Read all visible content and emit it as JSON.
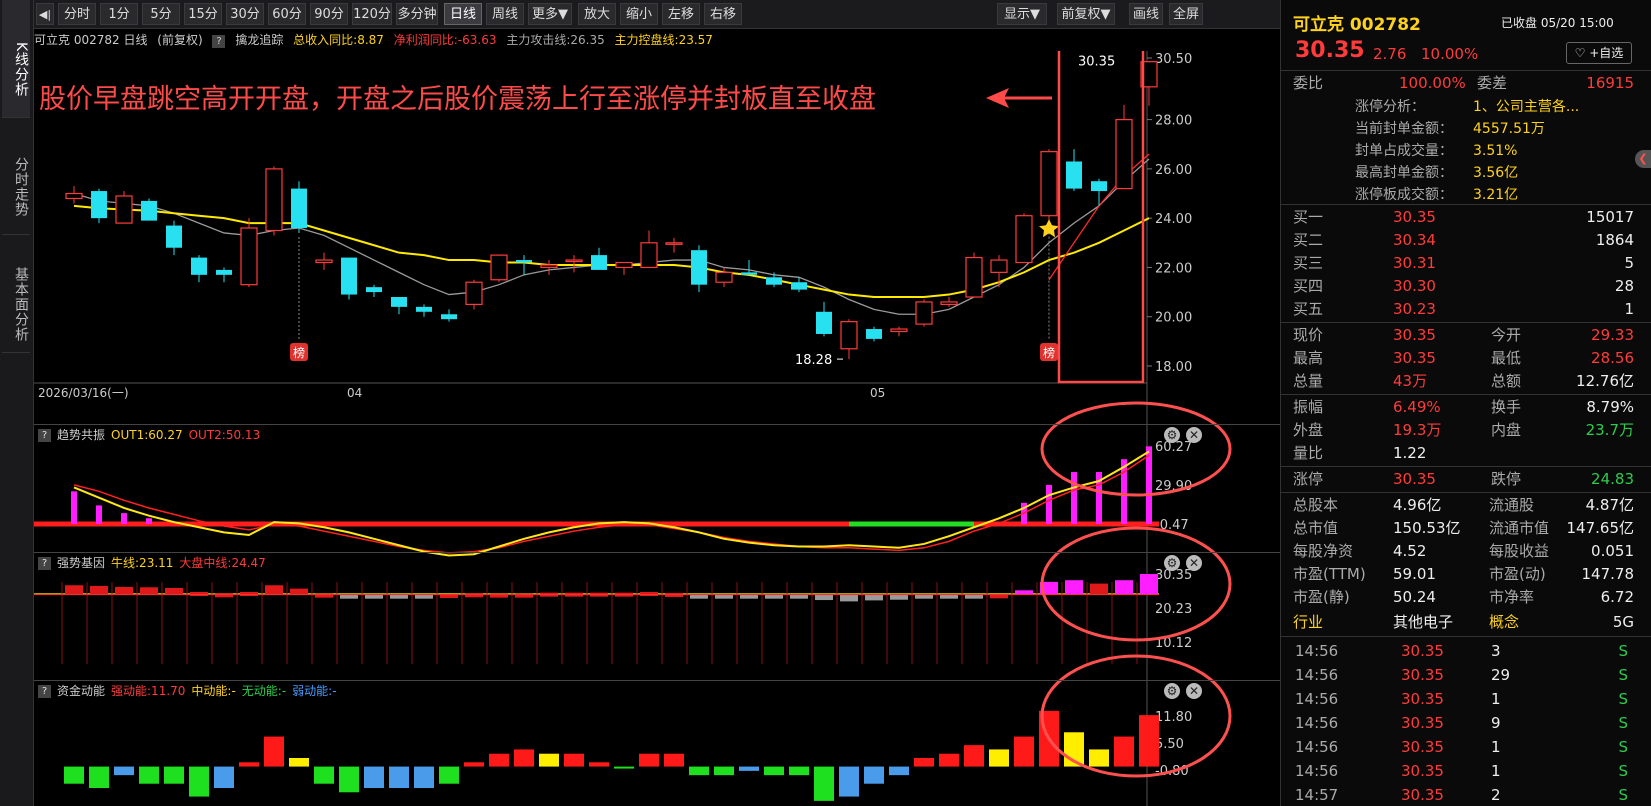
{
  "left_tabs": [
    "K线分析",
    "分时走势",
    "基本面分析"
  ],
  "toolbar": {
    "back": "◀|",
    "items": [
      "分时",
      "1分",
      "5分",
      "15分",
      "30分",
      "60分",
      "90分",
      "120分",
      "多分钟",
      "日线",
      "周线",
      "更多▼",
      "放大",
      "缩小",
      "左移",
      "右移"
    ],
    "right": [
      "显示▼",
      "前复权▼",
      "画线",
      "全屏"
    ]
  },
  "info": {
    "name": "可立克 002782 日线",
    "fq": "(前复权)",
    "q": "?",
    "ind": "擒龙追踪",
    "a": "总收入同比:8.87",
    "b": "净利润同比:-63.63",
    "c": "主力攻击线:26.35",
    "d": "主力控盘线:23.57"
  },
  "annotation": "股价早盘跳空高开开盘，开盘之后股价震荡上行至涨停并封板直至收盘",
  "main_chart": {
    "y_ticks": [
      "30.50",
      "28.00",
      "26.00",
      "24.00",
      "22.00",
      "20.00",
      "18.00"
    ],
    "x_labels": [
      "2026/03/16(一)",
      "04",
      "05"
    ],
    "high_label": "30.35",
    "low_label": "18.28",
    "bang": "榜",
    "candles": [
      [
        24.8,
        25.3,
        24.6,
        25.0
      ],
      [
        25.1,
        25.2,
        23.8,
        24.0
      ],
      [
        23.8,
        25.1,
        23.8,
        24.9
      ],
      [
        24.7,
        24.8,
        23.9,
        23.9
      ],
      [
        23.7,
        23.9,
        22.5,
        22.8
      ],
      [
        22.4,
        22.5,
        21.4,
        21.7
      ],
      [
        21.9,
        22.0,
        21.4,
        21.7
      ],
      [
        21.3,
        24.0,
        21.2,
        23.6
      ],
      [
        23.5,
        26.1,
        23.3,
        26.0
      ],
      [
        25.2,
        25.5,
        23.4,
        23.6
      ],
      [
        22.2,
        22.6,
        21.9,
        22.3
      ],
      [
        22.4,
        22.4,
        20.7,
        20.9
      ],
      [
        21.2,
        21.3,
        20.8,
        21.0
      ],
      [
        20.8,
        20.8,
        20.1,
        20.4
      ],
      [
        20.4,
        20.5,
        20.0,
        20.2
      ],
      [
        20.1,
        20.3,
        19.8,
        19.9
      ],
      [
        20.5,
        21.5,
        20.3,
        21.4
      ],
      [
        21.5,
        22.5,
        21.4,
        22.5
      ],
      [
        22.3,
        22.5,
        21.7,
        22.2
      ],
      [
        22.0,
        22.3,
        21.7,
        22.1
      ],
      [
        22.3,
        22.5,
        21.8,
        22.3
      ],
      [
        22.5,
        22.8,
        21.9,
        21.9
      ],
      [
        22.0,
        22.2,
        21.7,
        22.2
      ],
      [
        22.0,
        23.5,
        22.0,
        23.0
      ],
      [
        23.0,
        23.2,
        22.6,
        23.0
      ],
      [
        22.7,
        22.9,
        21.0,
        21.3
      ],
      [
        21.4,
        22.0,
        21.2,
        21.8
      ],
      [
        21.8,
        22.3,
        21.7,
        21.7
      ],
      [
        21.6,
        21.8,
        21.2,
        21.3
      ],
      [
        21.4,
        21.6,
        21.0,
        21.1
      ],
      [
        20.2,
        20.6,
        19.2,
        19.3
      ],
      [
        18.7,
        19.9,
        18.28,
        19.8
      ],
      [
        19.5,
        19.6,
        19.0,
        19.1
      ],
      [
        19.4,
        19.6,
        19.2,
        19.5
      ],
      [
        19.7,
        20.7,
        19.6,
        20.6
      ],
      [
        20.5,
        20.8,
        20.4,
        20.6
      ],
      [
        20.8,
        22.6,
        20.8,
        22.4
      ],
      [
        21.8,
        22.5,
        21.2,
        22.3
      ],
      [
        22.2,
        24.2,
        22.2,
        24.1
      ],
      [
        24.1,
        26.8,
        23.9,
        26.7
      ],
      [
        26.3,
        26.8,
        25.1,
        25.2
      ],
      [
        25.5,
        25.6,
        24.5,
        25.1
      ],
      [
        25.2,
        28.6,
        25.2,
        28.0
      ],
      [
        29.33,
        30.35,
        28.56,
        30.35
      ]
    ],
    "ma_yellow": [
      24.5,
      24.4,
      24.35,
      24.3,
      24.2,
      24.1,
      24.0,
      23.8,
      23.8,
      23.8,
      23.5,
      23.2,
      22.9,
      22.6,
      22.5,
      22.3,
      22.3,
      22.2,
      22.2,
      22.1,
      22.1,
      22.1,
      22.1,
      22.1,
      22.1,
      22.0,
      21.8,
      21.7,
      21.5,
      21.3,
      21.1,
      20.9,
      20.8,
      20.8,
      20.8,
      20.9,
      21.1,
      21.4,
      21.8,
      22.3,
      22.6,
      23.0,
      23.5,
      24.0
    ],
    "ma_gray": [
      25.0,
      24.7,
      24.6,
      24.5,
      24.2,
      23.8,
      23.4,
      23.3,
      23.5,
      23.6,
      23.3,
      22.8,
      22.3,
      21.8,
      21.3,
      20.9,
      21.0,
      21.3,
      21.7,
      21.9,
      22.0,
      22.1,
      22.1,
      22.2,
      22.3,
      22.3,
      22.0,
      21.9,
      21.7,
      21.6,
      21.2,
      20.7,
      20.3,
      20.1,
      20.1,
      20.3,
      20.8,
      21.3,
      22.0,
      23.0,
      23.8,
      24.5,
      25.5,
      26.4
    ],
    "ma_red": [
      null,
      null,
      null,
      null,
      null,
      null,
      null,
      null,
      null,
      null,
      null,
      null,
      null,
      null,
      null,
      null,
      null,
      null,
      null,
      null,
      null,
      null,
      null,
      null,
      null,
      null,
      null,
      null,
      null,
      null,
      null,
      null,
      null,
      null,
      null,
      null,
      null,
      null,
      null,
      21.5,
      23.0,
      24.5,
      25.7,
      26.6
    ]
  },
  "p1": {
    "title": "趋势共振",
    "a": "OUT1:60.27",
    "b": "OUT2:50.13",
    "ticks": [
      "60.27",
      "29.90",
      "-0.47"
    ],
    "bars": [
      25,
      14,
      8,
      4,
      0,
      0,
      0,
      0,
      0,
      0,
      0,
      0,
      0,
      0,
      0,
      0,
      0,
      0,
      0,
      0,
      0,
      0,
      0,
      0,
      0,
      0,
      0,
      0,
      0,
      0,
      0,
      0,
      0,
      0,
      0,
      0,
      0,
      0,
      16,
      30,
      40,
      40,
      50,
      60
    ],
    "l1": [
      28,
      20,
      12,
      6,
      1,
      -3,
      -7,
      -9,
      1,
      0,
      -3,
      -7,
      -12,
      -17,
      -22,
      -25,
      -24,
      -18,
      -12,
      -7,
      -3,
      0,
      1,
      0,
      -3,
      -7,
      -12,
      -15,
      -17,
      -18,
      -18,
      -17,
      -18,
      -19,
      -16,
      -10,
      -3,
      4,
      12,
      22,
      28,
      33,
      44,
      56
    ],
    "l2": [
      30,
      25,
      18,
      12,
      7,
      2,
      -2,
      -5,
      -1,
      -2,
      -6,
      -10,
      -14,
      -18,
      -21,
      -23,
      -22,
      -19,
      -14,
      -10,
      -6,
      -3,
      -1,
      -1,
      -4,
      -7,
      -11,
      -14,
      -16,
      -18,
      -19,
      -19,
      -20,
      -21,
      -19,
      -14,
      -6,
      0,
      8,
      18,
      26,
      30,
      40,
      53
    ],
    "green_from": 31,
    "green_to": 36
  },
  "p2": {
    "title": "强势基因",
    "a": "牛线:23.11",
    "b": "大盘中线:24.47",
    "ticks": [
      "30.35",
      "20.23",
      "10.12"
    ],
    "vals": [
      27,
      26.8,
      26.5,
      26.4,
      26.2,
      25,
      24.6,
      25,
      27,
      26,
      24.5,
      24,
      23.8,
      24,
      24.2,
      24.4,
      24.6,
      24.5,
      24.5,
      24.8,
      24.8,
      24.8,
      24.8,
      25,
      24.7,
      23.6,
      23.9,
      23.8,
      23.7,
      23.6,
      22.6,
      22.2,
      22.5,
      22.7,
      23,
      23.1,
      23.6,
      24.3,
      25.5,
      28,
      28.5,
      27.5,
      28.5,
      30.35
    ]
  },
  "p3": {
    "title": "资金动能",
    "a": "强动能:11.70",
    "b": "中动能:-",
    "c": "无动能:-",
    "d": "弱动能:-",
    "ticks": [
      "11.80",
      "5.50",
      "-0.80"
    ],
    "vals": [
      -4,
      -5,
      -2,
      -4,
      -4,
      -7,
      -5,
      1,
      7,
      2,
      -4,
      -6,
      -5,
      -5,
      -5,
      -4,
      1,
      3,
      4,
      3,
      3,
      1,
      0,
      3,
      3,
      -2,
      -2,
      -1,
      -2,
      -2,
      -8,
      -7,
      -4,
      -2,
      2,
      3,
      5,
      4,
      7,
      13,
      8,
      4,
      7,
      12
    ],
    "colors": [
      "g",
      "g",
      "b",
      "g",
      "g",
      "g",
      "b",
      "r",
      "r",
      "y",
      "g",
      "g",
      "b",
      "b",
      "b",
      "g",
      "r",
      "r",
      "r",
      "y",
      "r",
      "r",
      "g",
      "r",
      "r",
      "g",
      "g",
      "b",
      "g",
      "g",
      "g",
      "b",
      "b",
      "b",
      "r",
      "r",
      "r",
      "y",
      "r",
      "r",
      "y",
      "y",
      "r",
      "r"
    ]
  },
  "right": {
    "title": "可立克 002782",
    "status": "已收盘 05/20 15:00",
    "price": "30.35",
    "chg": "2.76",
    "pct": "10.00%",
    "fav": "+自选",
    "weibi_l": "委比",
    "weibi": "100.00%",
    "weicha_l": "委差",
    "weicha": "16915",
    "zt": [
      [
        "涨停分析：",
        "1、公司主营各..."
      ],
      [
        "当前封单金额：",
        "4557.51万"
      ],
      [
        "封单占成交量：",
        "3.51%"
      ],
      [
        "最高封单金额：",
        "3.56亿"
      ],
      [
        "涨停板成交额：",
        "3.21亿"
      ]
    ],
    "buy": [
      [
        "买一",
        "30.35",
        "15017"
      ],
      [
        "买二",
        "30.34",
        "1864"
      ],
      [
        "买三",
        "30.31",
        "5"
      ],
      [
        "买四",
        "30.30",
        "28"
      ],
      [
        "买五",
        "30.23",
        "1"
      ]
    ],
    "stats": [
      [
        "现价",
        "30.35",
        "今开",
        "29.33"
      ],
      [
        "最高",
        "30.35",
        "最低",
        "28.56"
      ],
      [
        "总量",
        "43万",
        "总额",
        "12.76亿"
      ]
    ],
    "stats2": [
      [
        "振幅",
        "6.49%",
        "换手",
        "8.79%"
      ],
      [
        "外盘",
        "19.3万",
        "内盘",
        "23.7万"
      ],
      [
        "量比",
        "1.22",
        "",
        ""
      ]
    ],
    "limit": [
      "涨停",
      "30.35",
      "跌停",
      "24.83"
    ],
    "fund": [
      [
        "总股本",
        "4.96亿",
        "流通股",
        "4.87亿"
      ],
      [
        "总市值",
        "150.53亿",
        "流通市值",
        "147.65亿"
      ],
      [
        "每股净资",
        "4.52",
        "每股收益",
        "0.051"
      ],
      [
        "市盈(TTM)",
        "59.01",
        "市盈(动)",
        "147.78"
      ],
      [
        "市盈(静)",
        "50.24",
        "市净率",
        "6.72"
      ]
    ],
    "ind": [
      "行业",
      "其他电子",
      "概念",
      "5G"
    ],
    "ticks": [
      [
        "14:56",
        "30.35",
        "3",
        "S"
      ],
      [
        "14:56",
        "30.35",
        "29",
        "S"
      ],
      [
        "14:56",
        "30.35",
        "1",
        "S"
      ],
      [
        "14:56",
        "30.35",
        "9",
        "S"
      ],
      [
        "14:56",
        "30.35",
        "1",
        "S"
      ],
      [
        "14:56",
        "30.35",
        "1",
        "S"
      ],
      [
        "14:57",
        "30.35",
        "2",
        "S"
      ]
    ]
  }
}
